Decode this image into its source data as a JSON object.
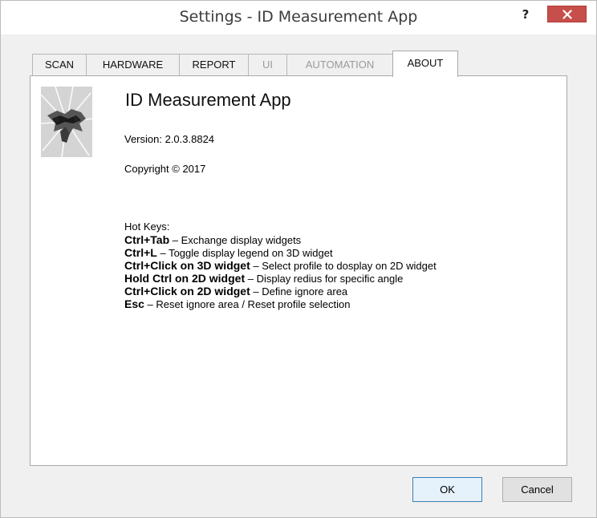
{
  "window": {
    "title": "Settings - ID Measurement App",
    "help_label": "?"
  },
  "tabs": [
    {
      "label": "SCAN",
      "state": "normal"
    },
    {
      "label": "HARDWARE",
      "state": "normal"
    },
    {
      "label": "REPORT",
      "state": "normal"
    },
    {
      "label": "UI",
      "state": "disabled"
    },
    {
      "label": "AUTOMATION",
      "state": "disabled"
    },
    {
      "label": "ABOUT",
      "state": "active"
    }
  ],
  "about": {
    "app_name": "ID Measurement App",
    "version": "Version: 2.0.3.8824",
    "copyright": "Copyright © 2017",
    "hotkeys_heading": "Hot Keys:",
    "hotkeys": [
      {
        "key": "Ctrl+Tab",
        "desc": " – Exchange display widgets"
      },
      {
        "key": "Ctrl+L",
        "desc": " – Toggle display legend on 3D widget"
      },
      {
        "key": "Ctrl+Click on 3D widget",
        "desc": " – Select profile to dosplay on 2D widget"
      },
      {
        "key": "Hold Ctrl on 2D widget",
        "desc": " – Display redius for specific angle"
      },
      {
        "key": "Ctrl+Click on 2D widget",
        "desc": " – Define ignore area"
      },
      {
        "key": "Esc",
        "desc": " – Reset ignore area / Reset profile selection"
      }
    ]
  },
  "buttons": {
    "ok_label": "OK",
    "cancel_label": "Cancel"
  },
  "icons": {
    "close": "close-icon",
    "logo": "app-logo-icon"
  },
  "colors": {
    "close_button": "#c74f4b",
    "window_background": "#f0f0f0",
    "panel_background": "#ffffff",
    "disabled_text": "#9a9a9a",
    "ok_border": "#3c7fb1"
  }
}
